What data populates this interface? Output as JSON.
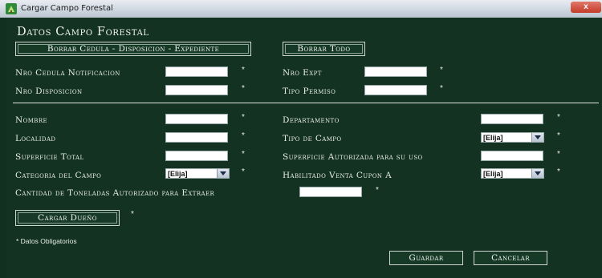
{
  "window": {
    "title": "Cargar Campo Forestal",
    "close": "x"
  },
  "heading": "Datos Campo Forestal",
  "top_buttons": {
    "borrar_cedula": "Borrar Cedula - Disposicion - Expediente",
    "borrar_todo": "Borrar Todo"
  },
  "fields": {
    "nro_cedula": "Nro Cedula Notificacion",
    "nro_expt": "Nro Expt",
    "nro_disposicion": "Nro Disposicion",
    "tipo_permiso": "Tipo Permiso",
    "nombre": "Nombre",
    "departamento": "Departamento",
    "localidad": "Localidad",
    "tipo_campo": "Tipo de Campo",
    "superficie_total": "Superficie Total",
    "superficie_autorizada": "Superficie Autorizada para su uso",
    "categoria": "Categoria del Campo",
    "habilitado_venta": "Habilitado Venta Cupon A",
    "cantidad_toneladas": "Cantidad de Toneladas Autorizado para Extraer"
  },
  "select_value": "[Elija]",
  "required_mark": "*",
  "buttons": {
    "cargar_dueno": "Cargar Dueño",
    "guardar": "Guardar",
    "cancelar": "Cancelar"
  },
  "note": "* Datos Obligatorios"
}
